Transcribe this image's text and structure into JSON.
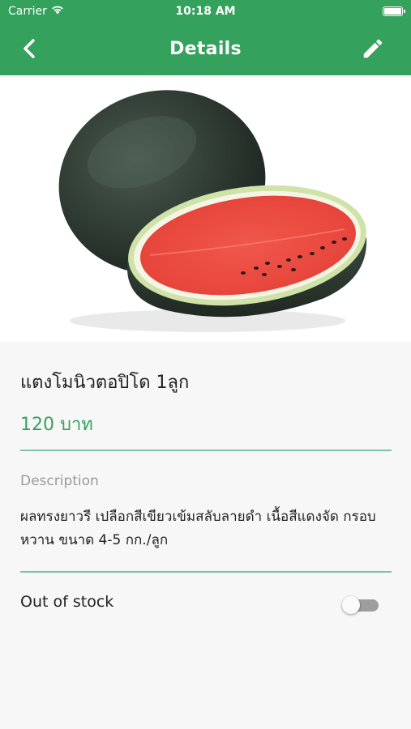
{
  "status_bar": {
    "carrier": "Carrier",
    "time": "10:18 AM",
    "wifi_icon": "wifi-icon",
    "battery_icon": "battery-full-icon"
  },
  "nav": {
    "title": "Details",
    "back_icon": "chevron-left-icon",
    "edit_icon": "pencil-icon",
    "background_color": "#34a15c"
  },
  "product": {
    "image_subject": "watermelon",
    "name": "แตงโมนิวตอปิโด 1ลูก",
    "price": "120 บาท",
    "price_color": "#34a15c",
    "description_label": "Description",
    "description": "ผลทรงยาวรี เปลือกสีเขียวเข้มสลับลายดำ เนื้อสีแดงจัด กรอบ หวาน ขนาด 4-5 กก./ลูก",
    "out_of_stock_label": "Out of stock",
    "out_of_stock": false
  }
}
